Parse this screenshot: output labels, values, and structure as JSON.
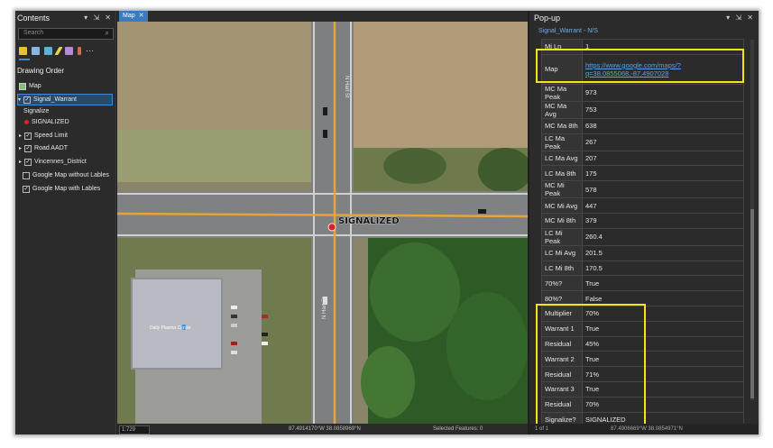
{
  "contents": {
    "title": "Contents",
    "controls": "▾ ⇲ ✕",
    "search_placeholder": "Search",
    "search_icon": "⌕",
    "heading": "Drawing Order",
    "map_item": "Map",
    "layers": [
      {
        "label": "Signal_Warrant",
        "checked": true,
        "selected": true
      },
      {
        "label": "Signalize",
        "type": "group"
      },
      {
        "label": "SIGNALIZED",
        "type": "legend"
      },
      {
        "label": "Speed Limit",
        "checked": true
      },
      {
        "label": "Road AADT",
        "checked": true
      },
      {
        "label": "Vincennes_District",
        "checked": true
      },
      {
        "label": "Google Map without Lables",
        "checked": false
      },
      {
        "label": "Google Map with Lables",
        "checked": true
      }
    ]
  },
  "map": {
    "tab_label": "Map",
    "tab_close": "✕",
    "label": "SIGNALIZED",
    "business_label": "Daily Plasma Center",
    "road_label": "N Hart St",
    "road_label_2": "N Hart St",
    "scale": "1:729",
    "coordinates": "87.4914170°W 38.0858969°N",
    "selected_features": "Selected Features: 0"
  },
  "popup": {
    "title": "Pop-up",
    "controls": "▾ ⇲ ✕",
    "layer_name": "Signal_Warrant - N/S",
    "rows": [
      {
        "key": "Mi Ln",
        "value": "1"
      },
      {
        "key": "Map",
        "value": "https://www.google.com/maps/?q=38.0855068,-87.4907028"
      },
      {
        "key": "MC Ma Peak",
        "value": "973"
      },
      {
        "key": "MC Ma Avg",
        "value": "753"
      },
      {
        "key": "MC Ma 8th",
        "value": "638"
      },
      {
        "key": "LC Ma Peak",
        "value": "267"
      },
      {
        "key": "LC Ma Avg",
        "value": "207"
      },
      {
        "key": "LC Ma 8th",
        "value": "175"
      },
      {
        "key": "MC Mi Peak",
        "value": "578"
      },
      {
        "key": "MC Mi Avg",
        "value": "447"
      },
      {
        "key": "MC Mi 8th",
        "value": "379"
      },
      {
        "key": "LC Mi Peak",
        "value": "260.4"
      },
      {
        "key": "LC Mi Avg",
        "value": "201.5"
      },
      {
        "key": "LC Mi 8th",
        "value": "170.5"
      },
      {
        "key": "70%?",
        "value": "True"
      },
      {
        "key": "80%?",
        "value": "False"
      },
      {
        "key": "Multiplier",
        "value": "70%"
      },
      {
        "key": "Warrant 1",
        "value": "True"
      },
      {
        "key": "Residual",
        "value": "45%"
      },
      {
        "key": "Warrant 2",
        "value": "True"
      },
      {
        "key": "Residual",
        "value": "71%"
      },
      {
        "key": "Warrant 3",
        "value": "True"
      },
      {
        "key": "Residual",
        "value": "70%"
      },
      {
        "key": "Signalize?",
        "value": "SIGNALIZED"
      }
    ],
    "status_page": "1 of 1",
    "status_coords": "87.4906669°W 38.0854971°N"
  },
  "colors": {
    "highlight": "#f5e21c",
    "accent": "#3d8bd6",
    "signal_point": "#e02020",
    "road_line": "#e8a33a"
  }
}
